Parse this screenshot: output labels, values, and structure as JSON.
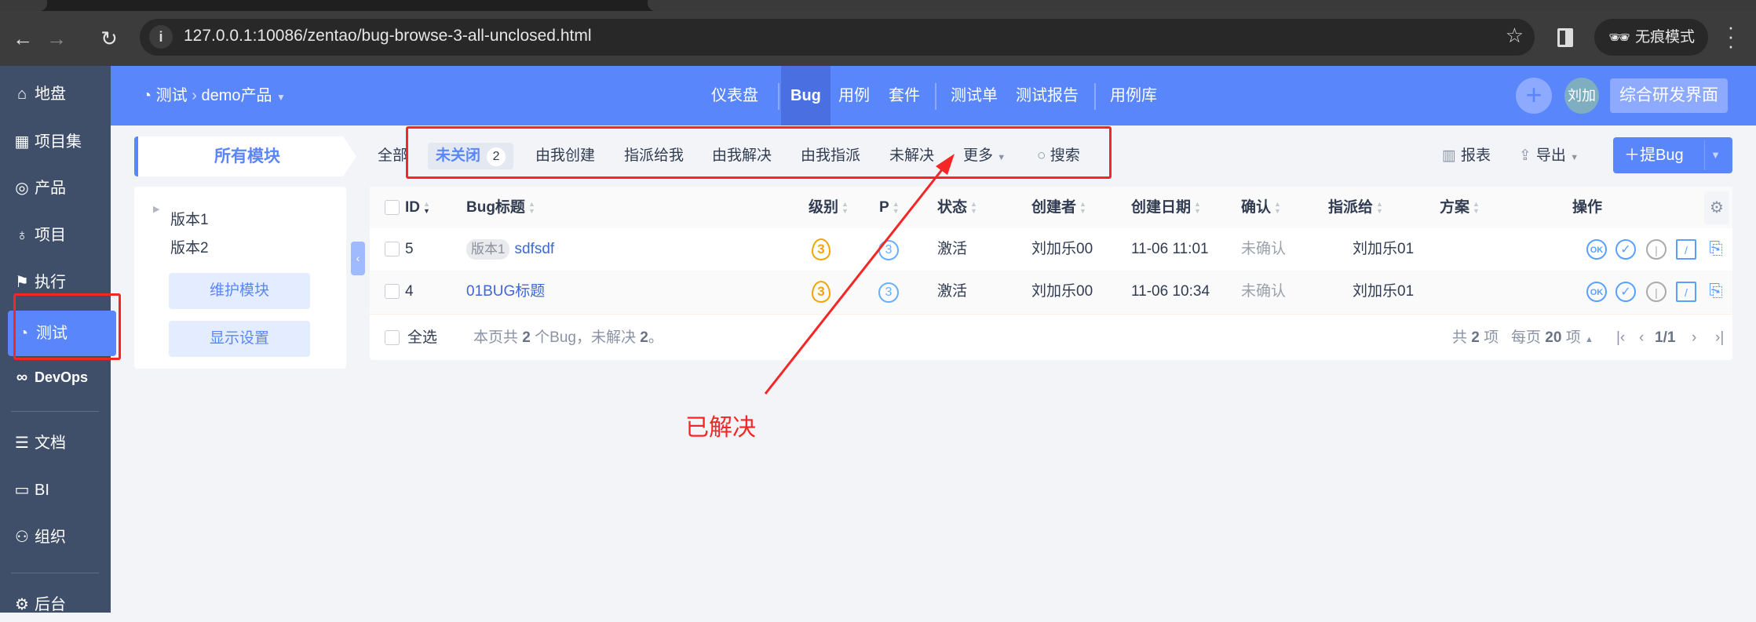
{
  "browser": {
    "url": "127.0.0.1:10086/zentao/bug-browse-3-all-unclosed.html",
    "incognito": "无痕模式"
  },
  "sidebar": {
    "items": [
      {
        "label": "地盘",
        "icon": "home-icon"
      },
      {
        "label": "项目集",
        "icon": "grid-icon"
      },
      {
        "label": "产品",
        "icon": "bulb-icon"
      },
      {
        "label": "项目",
        "icon": "rocket-icon"
      },
      {
        "label": "执行",
        "icon": "run-icon"
      },
      {
        "label": "测试",
        "icon": "test-icon"
      },
      {
        "label": "DevOps",
        "icon": "infinity-icon"
      },
      {
        "label": "文档",
        "icon": "doc-icon"
      },
      {
        "label": "BI",
        "icon": "chart-icon"
      },
      {
        "label": "组织",
        "icon": "people-icon"
      },
      {
        "label": "后台",
        "icon": "gear-icon"
      }
    ]
  },
  "header": {
    "crumb_module": "测试",
    "crumb_product": "demo产品",
    "nav": [
      "仪表盘",
      "Bug",
      "用例",
      "套件",
      "测试单",
      "测试报告",
      "用例库"
    ],
    "avatar": "刘加",
    "switch": "综合研发界面"
  },
  "module_tab": "所有模块",
  "filters": {
    "all": "全部",
    "unclosed": "未关闭",
    "unclosed_count": "2",
    "created": "由我创建",
    "assigned": "指派给我",
    "resolved_by_me": "由我解决",
    "assigned_by_me": "由我指派",
    "unresolved": "未解决",
    "more": "更多",
    "search": "搜索"
  },
  "toolbar": {
    "report": "报表",
    "export": "导出",
    "new_bug": "提Bug"
  },
  "tree": {
    "items": [
      "版本1",
      "版本2"
    ],
    "maintain": "维护模块",
    "display": "显示设置"
  },
  "table": {
    "columns": [
      "ID",
      "Bug标题",
      "级别",
      "P",
      "状态",
      "创建者",
      "创建日期",
      "确认",
      "指派给",
      "方案",
      "操作"
    ],
    "rows": [
      {
        "id": "5",
        "tag": "版本1",
        "title": "sdfsdf",
        "severity": "3",
        "pri": "3",
        "status": "激活",
        "creator": "刘加乐00",
        "date": "11-06 11:01",
        "confirm": "未确认",
        "assignee": "刘加乐01",
        "resolution": ""
      },
      {
        "id": "4",
        "tag": "",
        "title": "01BUG标题",
        "severity": "3",
        "pri": "3",
        "status": "激活",
        "creator": "刘加乐00",
        "date": "11-06 10:34",
        "confirm": "未确认",
        "assignee": "刘加乐01",
        "resolution": ""
      }
    ],
    "footer": {
      "select_all": "全选",
      "summary_a": "本页共",
      "count": "2",
      "summary_b": "个Bug，未解决",
      "unresolved": "2",
      "summary_c": "。",
      "total_a": "共",
      "total": "2",
      "total_b": "项",
      "per_a": "每页",
      "per": "20",
      "per_b": "项",
      "page": "1/1"
    }
  },
  "annotation": {
    "text": "已解决",
    "color": "#f52626"
  }
}
